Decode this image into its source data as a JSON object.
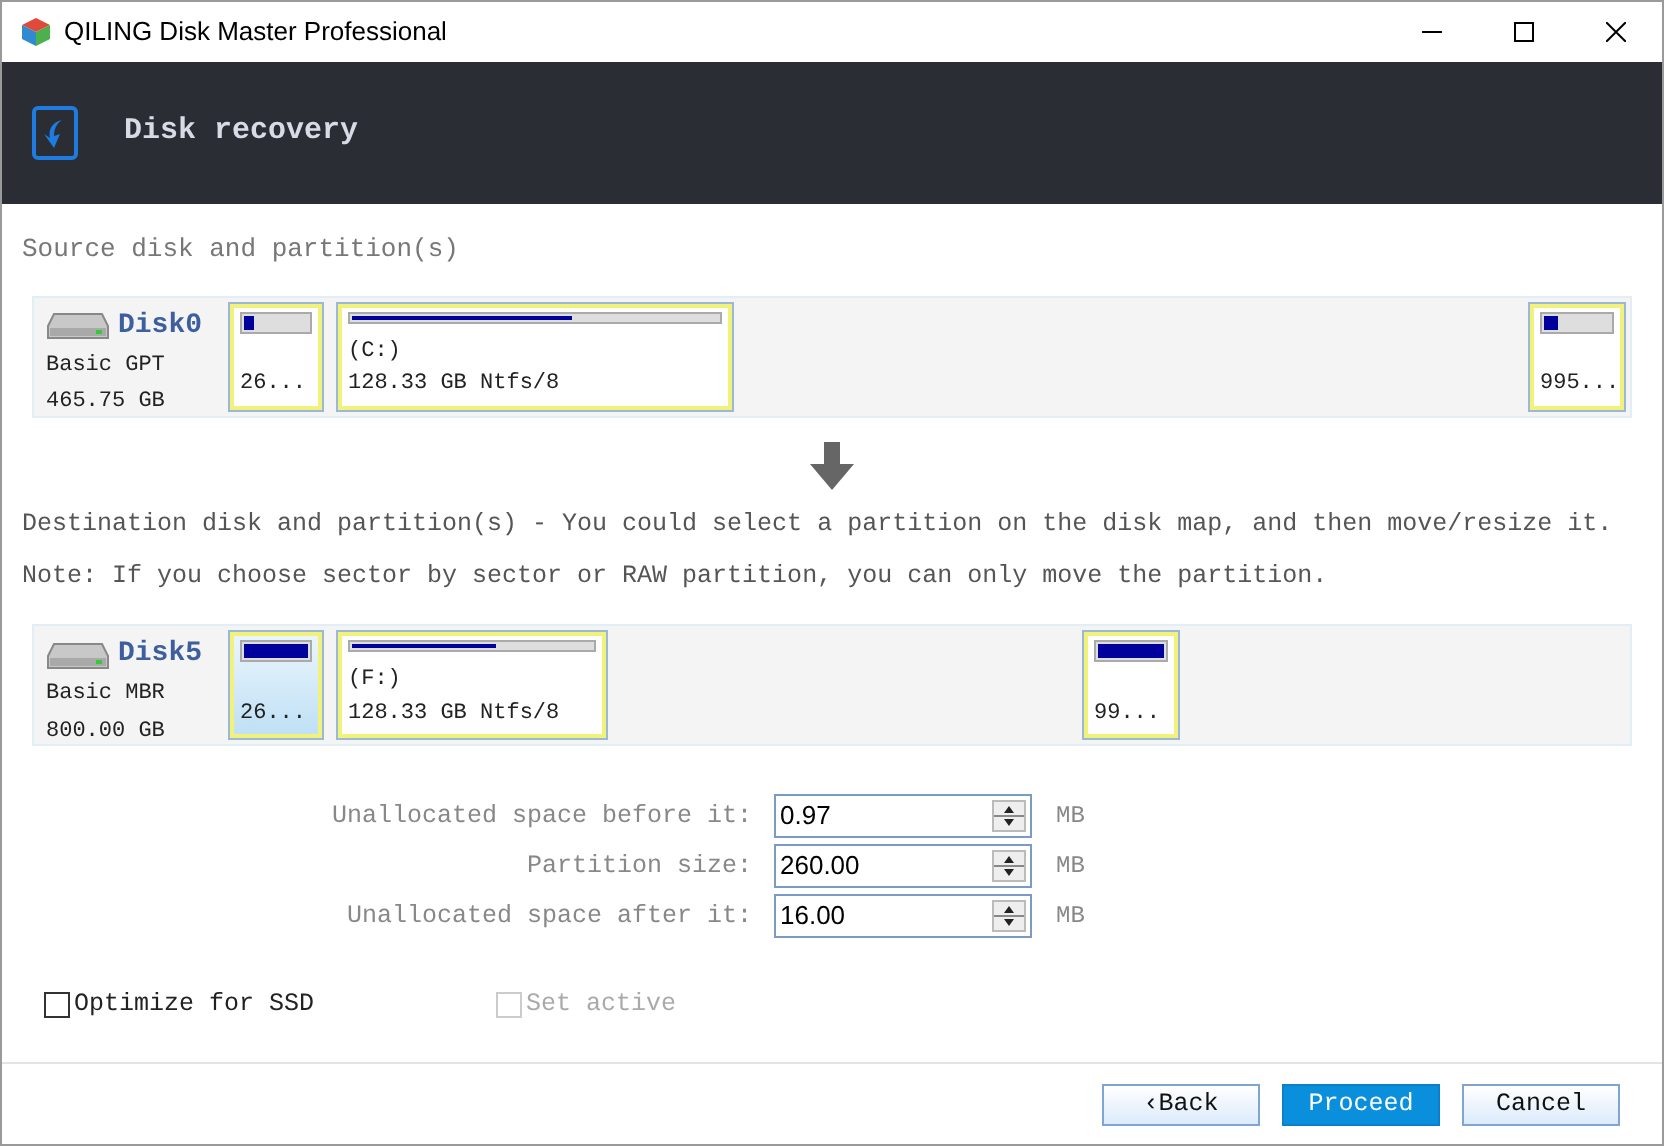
{
  "window": {
    "title": "QILING Disk Master Professional"
  },
  "header": {
    "title": "Disk recovery"
  },
  "source": {
    "label": "Source disk and partition(s)",
    "disk": {
      "name": "Disk0",
      "type": "Basic GPT",
      "size": "465.75 GB",
      "partitions": [
        {
          "info": "26...",
          "level": 0.15,
          "selected": false
        },
        {
          "letter": "(C:)",
          "info": "128.33 GB Ntfs/8",
          "level": 0.6,
          "selected": false
        },
        {
          "info": "995...",
          "level": 0.2,
          "selected": false
        }
      ]
    }
  },
  "destination": {
    "label": "Destination disk and partition(s) - You could select a partition on the disk map, and then move/resize it.",
    "note": "Note: If you choose sector by sector or RAW partition, you can only move the partition.",
    "disk": {
      "name": "Disk5",
      "type": "Basic MBR",
      "size": "800.00 GB",
      "partitions": [
        {
          "info": "26...",
          "level": 1,
          "selected": true
        },
        {
          "letter": "(F:)",
          "info": "128.33 GB Ntfs/8",
          "level": 0.6,
          "selected": false
        },
        {
          "info": "99...",
          "level": 1,
          "selected": false
        }
      ]
    }
  },
  "fields": [
    {
      "label": "Unallocated space before it:",
      "value": "0.97",
      "unit": "MB"
    },
    {
      "label": "Partition size:",
      "value": "260.00",
      "unit": "MB"
    },
    {
      "label": "Unallocated space after it:",
      "value": "16.00",
      "unit": "MB"
    }
  ],
  "options": [
    {
      "label": "Optimize for SSD",
      "checked": false,
      "disabled": false
    },
    {
      "label": "Set active",
      "checked": false,
      "disabled": true
    }
  ],
  "buttons": [
    {
      "label": "‹Back",
      "kind": "normal"
    },
    {
      "label": "Proceed",
      "kind": "primary"
    },
    {
      "label": "Cancel",
      "kind": "normal"
    }
  ]
}
